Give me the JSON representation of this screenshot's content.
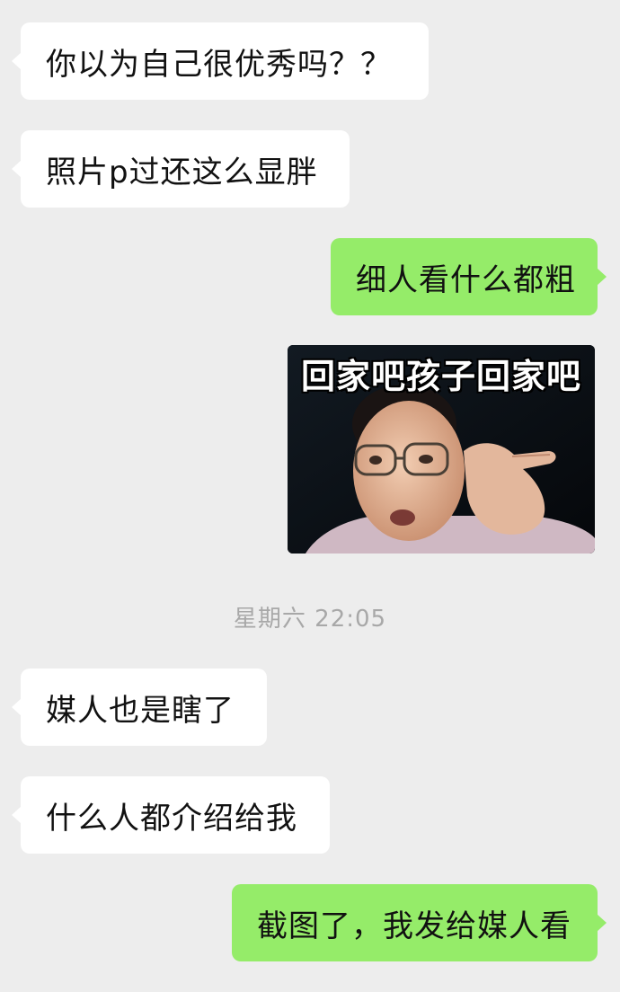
{
  "messages": [
    {
      "side": "left",
      "text": "你以为自己很优秀吗？？"
    },
    {
      "side": "left",
      "text": "照片p过还这么显胖"
    },
    {
      "side": "right",
      "text": "细人看什么都粗"
    },
    {
      "side": "right",
      "type": "sticker",
      "caption": "回家吧孩子回家吧"
    },
    {
      "side": "left",
      "text": "媒人也是瞎了"
    },
    {
      "side": "left",
      "text": "什么人都介绍给我"
    },
    {
      "side": "right",
      "text": "截图了，我发给媒人看"
    }
  ],
  "timestamp": "星期六 22:05",
  "colors": {
    "background": "#ededed",
    "incoming_bubble": "#ffffff",
    "outgoing_bubble": "#95ec69",
    "timestamp_text": "#a8a8a8"
  }
}
